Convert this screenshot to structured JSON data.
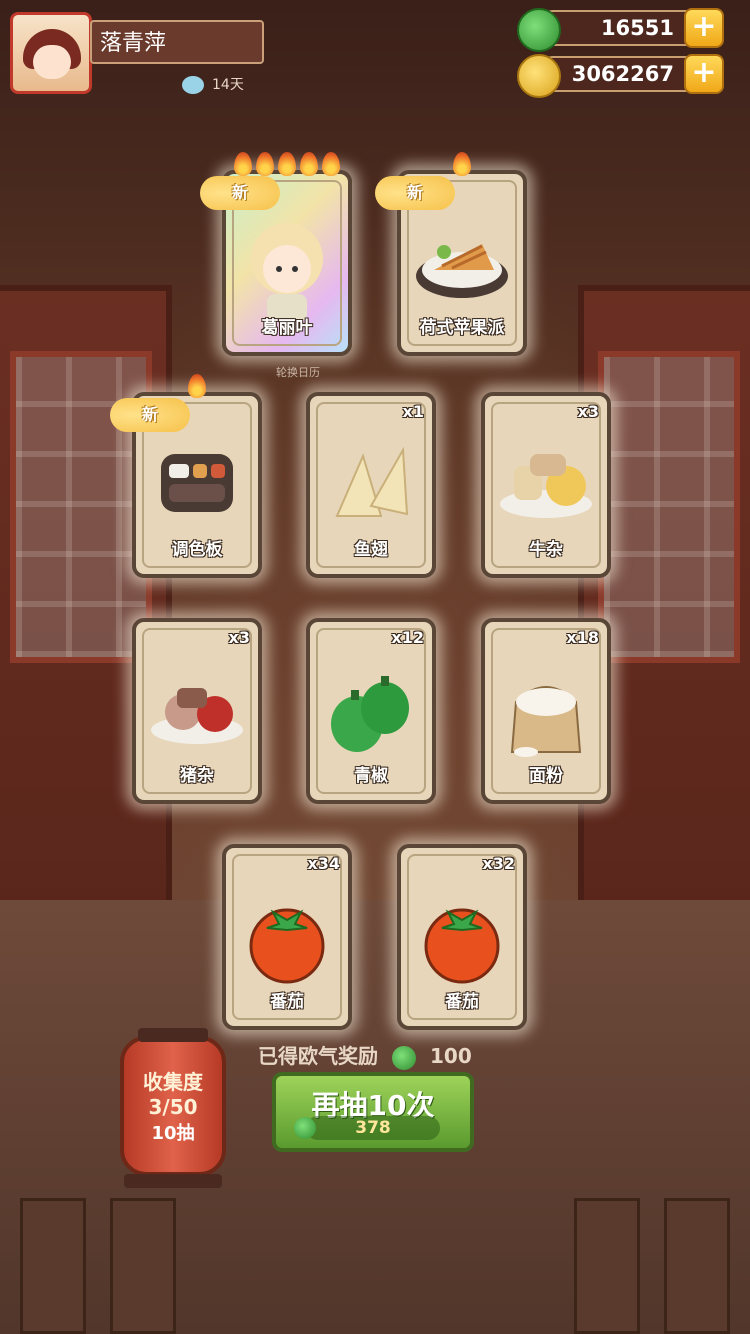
{
  "player": {
    "name": "落青萍",
    "days_label": "14天"
  },
  "currencies": {
    "jade": "16551",
    "coins": "3062267"
  },
  "section_hint": "轮换日历",
  "cards": [
    {
      "name": "葛丽叶",
      "count": "",
      "is_new": true,
      "flames": 5,
      "art": "character"
    },
    {
      "name": "荷式苹果派",
      "count": "",
      "is_new": true,
      "flames": 1,
      "art": "apple-pie"
    },
    {
      "name": "调色板",
      "count": "",
      "is_new": true,
      "flames": 1,
      "art": "palette"
    },
    {
      "name": "鱼翅",
      "count": "x1",
      "is_new": false,
      "flames": 0,
      "art": "shark-fin"
    },
    {
      "name": "牛杂",
      "count": "x3",
      "is_new": false,
      "flames": 0,
      "art": "beef-offal"
    },
    {
      "name": "猪杂",
      "count": "x3",
      "is_new": false,
      "flames": 0,
      "art": "pork-offal"
    },
    {
      "name": "青椒",
      "count": "x12",
      "is_new": false,
      "flames": 0,
      "art": "green-pepper"
    },
    {
      "name": "面粉",
      "count": "x18",
      "is_new": false,
      "flames": 0,
      "art": "flour"
    },
    {
      "name": "番茄",
      "count": "x34",
      "is_new": false,
      "flames": 0,
      "art": "tomato"
    },
    {
      "name": "番茄",
      "count": "x32",
      "is_new": false,
      "flames": 0,
      "art": "tomato"
    }
  ],
  "new_badge_label": "新",
  "reward": {
    "label": "已得欧气奖励",
    "value": "100"
  },
  "redraw": {
    "label": "再抽10次",
    "cost": "378"
  },
  "collection": {
    "title": "收集度",
    "progress": "3/50",
    "subtitle": "10抽"
  }
}
